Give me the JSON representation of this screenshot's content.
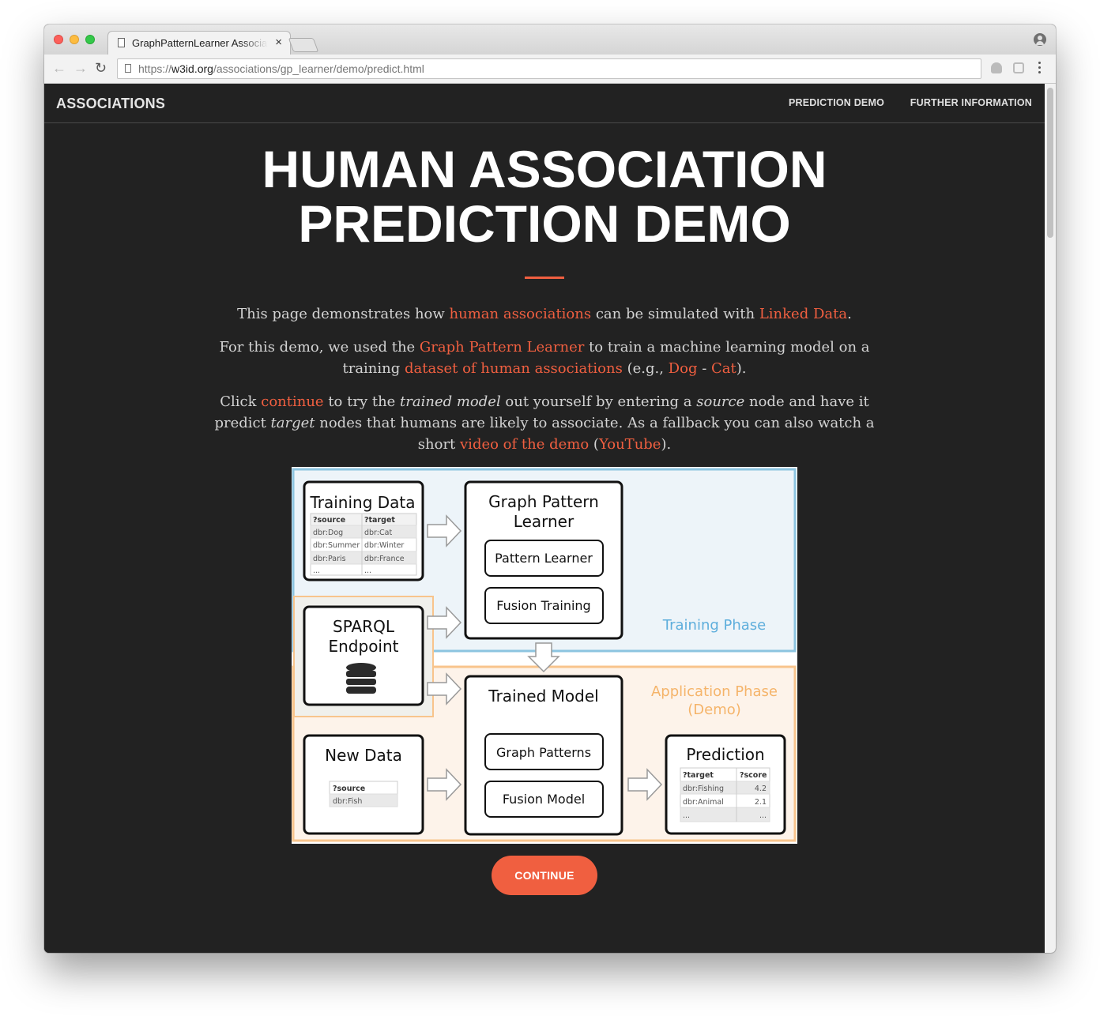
{
  "browser": {
    "tab_title": "GraphPatternLearner Associati",
    "tab_close": "×",
    "url_prefix": "https://",
    "url_host": "w3id.org",
    "url_path": "/associations/gp_learner/demo/predict.html"
  },
  "nav": {
    "brand": "ASSOCIATIONS",
    "links": [
      "PREDICTION DEMO",
      "FURTHER INFORMATION"
    ]
  },
  "hero": {
    "title_line1": "HUMAN ASSOCIATION",
    "title_line2": "PREDICTION DEMO"
  },
  "intro": {
    "p1": [
      "This page demonstrates how ",
      "human associations",
      " can be simulated with ",
      "Linked Data",
      "."
    ],
    "p2": [
      "For this demo, we used the ",
      "Graph Pattern Learner",
      " to train a machine learning model on a training ",
      "dataset of human associations",
      " (e.g., ",
      "Dog",
      " - ",
      "Cat",
      ")."
    ],
    "p3": [
      "Click ",
      "continue",
      " to try the ",
      "trained model",
      " out yourself by entering a ",
      "source",
      " node and have it predict ",
      "target",
      " nodes that humans are likely to associate. As a fallback you can also watch a short ",
      "video of the demo",
      " (",
      "YouTube",
      ")."
    ]
  },
  "diagram": {
    "training_data_title": "Training Data",
    "training_table": [
      [
        "?source",
        "?target"
      ],
      [
        "dbr:Dog",
        "dbr:Cat"
      ],
      [
        "dbr:Summer",
        "dbr:Winter"
      ],
      [
        "dbr:Paris",
        "dbr:France"
      ],
      [
        "...",
        "..."
      ]
    ],
    "gpl_title_1": "Graph Pattern",
    "gpl_title_2": "Learner",
    "pattern_learner": "Pattern Learner",
    "fusion_training": "Fusion Training",
    "training_phase": "Training Phase",
    "sparql_1": "SPARQL",
    "sparql_2": "Endpoint",
    "trained_model": "Trained Model",
    "graph_patterns": "Graph Patterns",
    "fusion_model": "Fusion Model",
    "application_phase_1": "Application Phase",
    "application_phase_2": "(Demo)",
    "new_data_title": "New Data",
    "new_data_table": [
      [
        "?source"
      ],
      [
        "dbr:Fish"
      ]
    ],
    "prediction_title": "Prediction",
    "prediction_table": [
      [
        "?target",
        "?score"
      ],
      [
        "dbr:Fishing",
        "4.2"
      ],
      [
        "dbr:Animal",
        "2.1"
      ],
      [
        "...",
        "..."
      ]
    ]
  },
  "cta": {
    "continue": "CONTINUE"
  },
  "colors": {
    "accent": "#f05f40",
    "background": "#222222",
    "training_blue": "#8cc4e0",
    "application_orange": "#f8c48c"
  }
}
